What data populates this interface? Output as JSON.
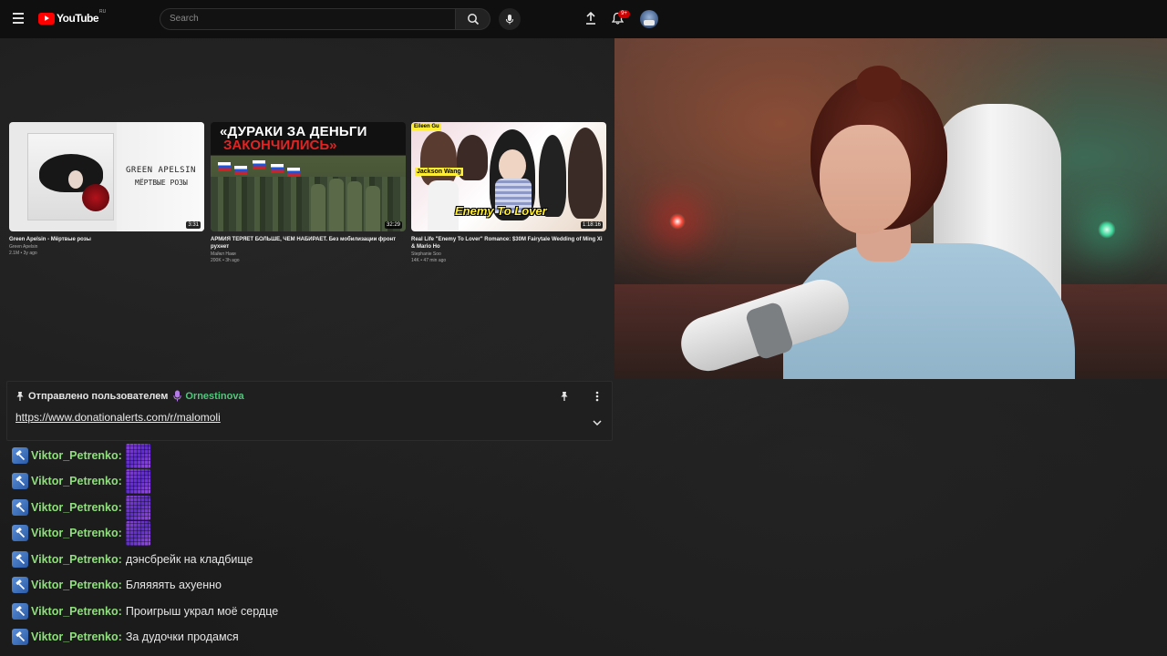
{
  "youtube": {
    "logo_text": "YouTube",
    "region": "RU",
    "search_placeholder": "Search",
    "notification_count": "9+",
    "icons": [
      "menu-icon",
      "search-icon",
      "mic-icon",
      "upload-icon",
      "bell-icon"
    ]
  },
  "videos": [
    {
      "title": "Green Apelsin - Мёртвые розы",
      "channel": "Green Apelsin",
      "meta": "2.1M • 3y ago",
      "duration": "3:31",
      "thumb_text": [
        "GREEN APELSIN",
        "МЁРТВЫЕ РОЗЫ"
      ]
    },
    {
      "title": "АРМИЯ ТЕРЯЕТ БОЛЬШЕ, ЧЕМ НАБИРАЕТ. Без мобилизации фронт рухнет",
      "channel": "Майкл Наки",
      "meta": "200K • 3h ago",
      "duration": "32:29",
      "thumb_text": [
        "«ДУРАКИ ЗА ДЕНЬГИ",
        "ЗАКОНЧИЛИСЬ»"
      ]
    },
    {
      "title": "Real Life \"Enemy To Lover\" Romance: $30M Fairytale Wedding of Ming Xi & Mario Ho",
      "channel": "Stephanie Soo",
      "meta": "14K • 47 min ago",
      "duration": "1:18:16",
      "thumb_text": [
        "Eileen Gu",
        "Jackson Wang",
        "Enemy To Lover"
      ]
    }
  ],
  "pinned": {
    "label": "Отправлено пользователем",
    "user": "Ornestinova",
    "link": "https://www.donationalerts.com/r/malomoli"
  },
  "chat": {
    "messages": [
      {
        "user": "Viktor_Petrenko",
        "text": "",
        "emote": true
      },
      {
        "user": "Viktor_Petrenko",
        "text": "",
        "emote": true
      },
      {
        "user": "Viktor_Petrenko",
        "text": "",
        "emote": true
      },
      {
        "user": "Viktor_Petrenko",
        "text": "",
        "emote": true
      },
      {
        "user": "Viktor_Petrenko",
        "text": "дэнсбрейк на кладбище",
        "emote": false
      },
      {
        "user": "Viktor_Petrenko",
        "text": "Бляяяять ахуенно",
        "emote": false
      },
      {
        "user": "Viktor_Petrenko",
        "text": "Проигрыш украл моё сердце",
        "emote": false
      },
      {
        "user": "Viktor_Petrenko",
        "text": "За дудочки продамся",
        "emote": false
      }
    ]
  },
  "colors": {
    "username": "#8ee07a",
    "pinned_user": "#4fc87c",
    "yt_red": "#ff0000"
  }
}
